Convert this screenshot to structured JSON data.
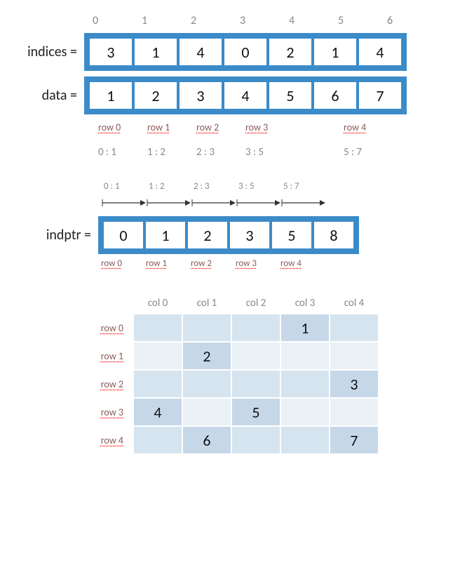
{
  "labels": {
    "indices": "indices =",
    "data": "data =",
    "indptr": "indptr ="
  },
  "top_col_indices": [
    "0",
    "1",
    "2",
    "3",
    "4",
    "5",
    "6"
  ],
  "indices_array": [
    "3",
    "1",
    "4",
    "0",
    "2",
    "1",
    "4"
  ],
  "data_array": [
    "1",
    "2",
    "3",
    "4",
    "5",
    "6",
    "7"
  ],
  "row_segments": [
    {
      "label": "row 0",
      "slice": "0 : 1"
    },
    {
      "label": "row 1",
      "slice": "1 : 2"
    },
    {
      "label": "row 2",
      "slice": "2 : 3"
    },
    {
      "label": "row 3",
      "slice": "3 : 5"
    },
    {
      "label": "row 4",
      "slice": "5 : 7"
    }
  ],
  "indptr_arrows": [
    "0 : 1",
    "1 : 2",
    "2 : 3",
    "3 : 5",
    "5 : 7"
  ],
  "indptr_array": [
    "0",
    "1",
    "2",
    "3",
    "5",
    "8"
  ],
  "indptr_row_labels": [
    "row 0",
    "row 1",
    "row 2",
    "row 3",
    "row 4"
  ],
  "matrix": {
    "col_headers": [
      "col 0",
      "col 1",
      "col 2",
      "col 3",
      "col 4"
    ],
    "row_headers": [
      "row 0",
      "row 1",
      "row 2",
      "row 3",
      "row 4"
    ],
    "cells": [
      [
        "",
        "",
        "",
        "1",
        ""
      ],
      [
        "",
        "2",
        "",
        "",
        ""
      ],
      [
        "",
        "",
        "",
        "",
        "3"
      ],
      [
        "4",
        "",
        "5",
        "",
        ""
      ],
      [
        "",
        "6",
        "",
        "",
        "7"
      ]
    ]
  },
  "chart_data": {
    "type": "table",
    "title": "CSR sparse matrix format illustration",
    "csr": {
      "indices": [
        3,
        1,
        4,
        0,
        2,
        1,
        4
      ],
      "data": [
        1,
        2,
        3,
        4,
        5,
        6,
        7
      ],
      "indptr": [
        0,
        1,
        2,
        3,
        5,
        8
      ],
      "row_slices": [
        "0:1",
        "1:2",
        "2:3",
        "3:5",
        "5:7"
      ]
    },
    "dense_matrix": {
      "columns": [
        "col 0",
        "col 1",
        "col 2",
        "col 3",
        "col 4"
      ],
      "rows": [
        "row 0",
        "row 1",
        "row 2",
        "row 3",
        "row 4"
      ],
      "values": [
        [
          null,
          null,
          null,
          1,
          null
        ],
        [
          null,
          2,
          null,
          null,
          null
        ],
        [
          null,
          null,
          null,
          null,
          3
        ],
        [
          4,
          null,
          5,
          null,
          null
        ],
        [
          null,
          6,
          null,
          null,
          7
        ]
      ]
    }
  }
}
